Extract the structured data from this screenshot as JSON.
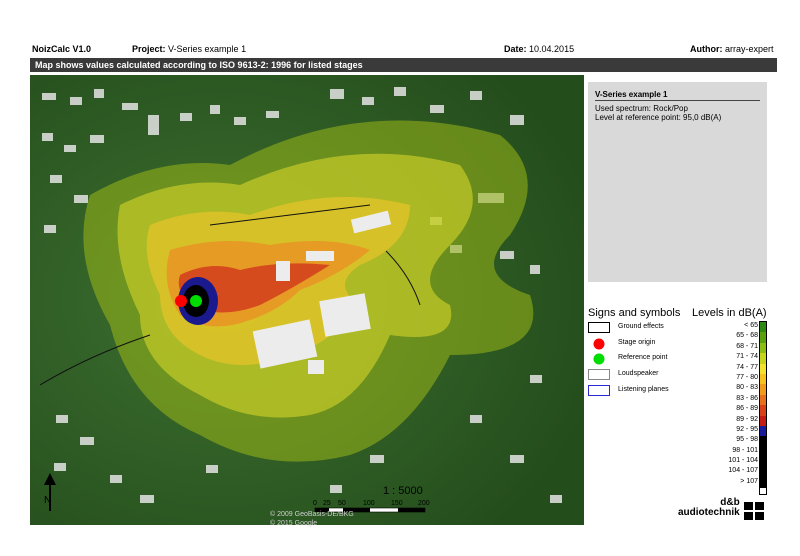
{
  "header": {
    "app": "NoizCalc V1.0",
    "project_label": "Project:",
    "project_value": "V-Series example 1",
    "date_label": "Date:",
    "date_value": "10.04.2015",
    "author_label": "Author:",
    "author_value": "array-expert"
  },
  "title_bar": "Map shows values calculated according to ISO 9613-2: 1996 for listed stages",
  "info": {
    "title": "V-Series example 1",
    "spectrum": "Used spectrum:  Rock/Pop",
    "level": "Level at reference point:  95,0 dB(A)"
  },
  "symbols": {
    "title": "Signs and symbols",
    "items": [
      {
        "label": "Ground effects",
        "icon": "ground-effects-icon"
      },
      {
        "label": "Stage origin",
        "icon": "red-dot-icon",
        "color": "#ff0000"
      },
      {
        "label": "Reference point",
        "icon": "green-dot-icon",
        "color": "#00dd00"
      },
      {
        "label": "Loudspeaker",
        "icon": "loudspeaker-icon"
      },
      {
        "label": "Listening planes",
        "icon": "listening-plane-icon",
        "color": "#2a2ad0"
      }
    ]
  },
  "levels": {
    "title": "Levels in dB(A)",
    "ranges": [
      "<  65",
      "65 -  68",
      "68 -  71",
      "71 -  74",
      "74 -  77",
      "77 -  80",
      "80 -  83",
      "83 -  86",
      "86 -  89",
      "89 -  92",
      "92 -  95",
      "95 -  98",
      "98 - 101",
      "101 - 104",
      "104 - 107",
      "> 107"
    ],
    "colors": [
      "#2c8a12",
      "#5aa00e",
      "#8cbd12",
      "#c7d51a",
      "#f0e32a",
      "#f7c21e",
      "#f29a1a",
      "#e8701c",
      "#d8401a",
      "#c41c14",
      "#1a1a9a",
      "#000000",
      "#000000",
      "#000000",
      "#000000",
      "#000000"
    ]
  },
  "map": {
    "scale": "1 : 5000",
    "scale_ticks": [
      "0",
      "25",
      "50",
      "100",
      "150",
      "200"
    ],
    "copyright_1": "© 2009 GeoBasis-DE/BKG",
    "copyright_2": "© 2015 Google"
  },
  "brand": {
    "line1": "d&b",
    "line2": "audiotechnik"
  }
}
